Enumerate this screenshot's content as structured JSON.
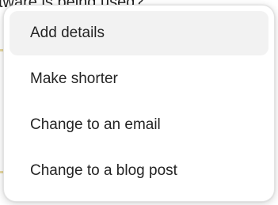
{
  "background": {
    "partial_text": "tware is being used?"
  },
  "menu": {
    "items": [
      {
        "label": "Add details",
        "active": true
      },
      {
        "label": "Make shorter",
        "active": false
      },
      {
        "label": "Change to an email",
        "active": false
      },
      {
        "label": "Change to a blog post",
        "active": false
      }
    ]
  },
  "colors": {
    "menu_background": "#ffffff",
    "hover_background": "#f2f2f2",
    "text": "#242424",
    "highlight_strip": "#e8d9a0"
  }
}
